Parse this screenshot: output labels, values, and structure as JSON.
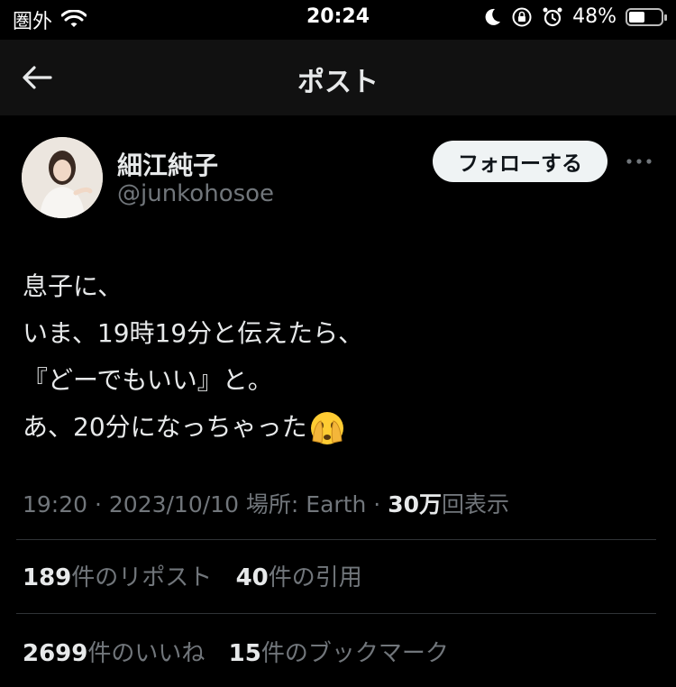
{
  "status_bar": {
    "carrier": "圏外",
    "time": "20:24",
    "battery": "48%",
    "battery_level": 0.48
  },
  "nav": {
    "title": "ポスト"
  },
  "author": {
    "name": "細江純子",
    "handle": "@junkohosoe",
    "follow_label": "フォローする"
  },
  "tweet": {
    "lines": [
      "息子に、",
      "いま、19時19分と伝えたら、",
      "『どーでもいい』と。",
      "あ、20分になっちゃった"
    ]
  },
  "meta": {
    "time": "19:20",
    "sep1": " · ",
    "date": "2023/10/10",
    "location": " 場所: Earth",
    "sep2": " · ",
    "views_count": "30万",
    "views_label": "回表示"
  },
  "stats": {
    "reposts_count": "189",
    "reposts_label": "件のリポスト",
    "quotes_count": "40",
    "quotes_label": "件の引用",
    "likes_count": "2699",
    "likes_label": "件のいいね",
    "bookmarks_count": "15",
    "bookmarks_label": "件のブックマーク"
  },
  "icons": {
    "back": "back-arrow-icon",
    "more": "more-horizontal-icon",
    "wifi": "wifi-icon",
    "moon": "moon-icon",
    "lock": "rotation-lock-icon",
    "alarm": "alarm-icon",
    "battery": "battery-icon",
    "emoji": "peeking-face-emoji"
  }
}
